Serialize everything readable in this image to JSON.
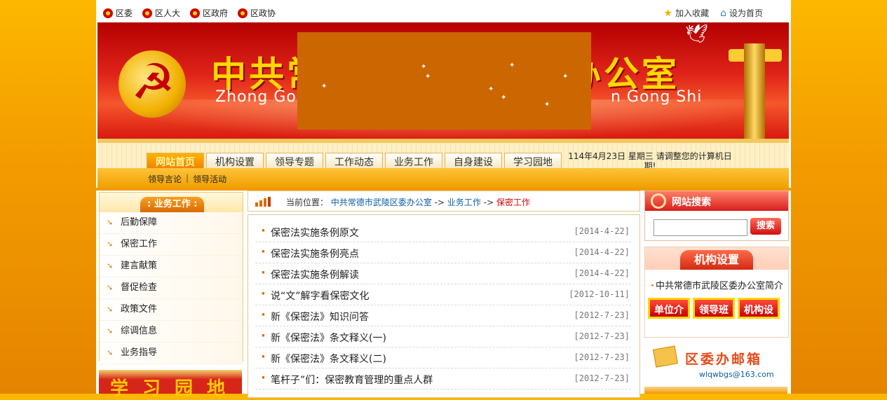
{
  "topbar": {
    "links": [
      "区委",
      "区人大",
      "区政府",
      "区政协"
    ],
    "favorite": "加入收藏",
    "homepage": "设为首页"
  },
  "banner": {
    "title_left": "中共常",
    "title_right": "办公室",
    "pinyin_left": "Zhong Go",
    "pinyin_right": "n Gong Shi"
  },
  "nav": {
    "tabs": [
      "网站首页",
      "机构设置",
      "领导专题",
      "工作动态",
      "业务工作",
      "自身建设",
      "学习园地"
    ],
    "date": "114年4月23日 星期三 请调整您的计算机日期!",
    "subnav": [
      "领导言论",
      "领导活动"
    ]
  },
  "sidebar": {
    "title": ": 业务工作 :",
    "items": [
      "后勤保障",
      "保密工作",
      "建言献策",
      "督促检查",
      "政策文件",
      "综调信息",
      "业务指导"
    ],
    "bottom_banner": "学习园地"
  },
  "breadcrumb": {
    "label": "当前位置：",
    "path1": "中共常德市武陵区委办公室",
    "arrow": "->",
    "path2": "业务工作",
    "current": "保密工作"
  },
  "articles": [
    {
      "title": "保密法实施条例原文",
      "date": "[2014-4-22]"
    },
    {
      "title": "保密法实施条例亮点",
      "date": "[2014-4-22]"
    },
    {
      "title": "保密法实施条例解读",
      "date": "[2014-4-22]"
    },
    {
      "title": "说“文”解字看保密文化",
      "date": "[2012-10-11]"
    },
    {
      "title": "新《保密法》知识问答",
      "date": "[2012-7-23]"
    },
    {
      "title": "新《保密法》条文释义(一)",
      "date": "[2012-7-23]"
    },
    {
      "title": "新《保密法》条文释义(二)",
      "date": "[2012-7-23]"
    },
    {
      "title": "笔杆子”们：保密教育管理的重点人群",
      "date": "[2012-7-23]"
    }
  ],
  "search": {
    "title": "网站搜索",
    "button": "搜索",
    "value": ""
  },
  "org": {
    "title": "机构设置",
    "link": "中共常德市武陵区委办公室简介",
    "buttons": [
      "单位介绍",
      "领导班子",
      "机构设置"
    ]
  },
  "mail": {
    "title": "区委办邮箱",
    "address": "wlqwbgs@163.com"
  }
}
